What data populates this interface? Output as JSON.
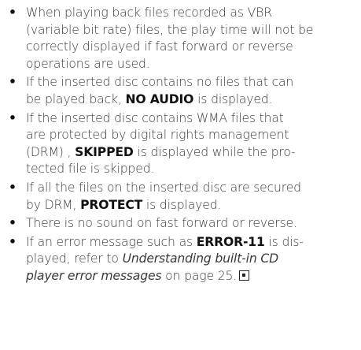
{
  "notes": [
    {
      "lines": [
        [
          {
            "t": "When playing back files recorded as VBR"
          }
        ],
        [
          {
            "t": "(variable bit rate) files, the play time will not be"
          }
        ],
        [
          {
            "t": "correctly displayed if fast forward or reverse"
          }
        ],
        [
          {
            "t": "operations are used."
          }
        ]
      ]
    },
    {
      "lines": [
        [
          {
            "t": "If the inserted disc contains no files that can"
          }
        ],
        [
          {
            "t": "be played back, "
          },
          {
            "t": "NO AUDIO",
            "s": "b"
          },
          {
            "t": " is displayed."
          }
        ]
      ]
    },
    {
      "lines": [
        [
          {
            "t": "If the inserted disc contains WMA files that"
          }
        ],
        [
          {
            "t": "are protected by digital rights management"
          }
        ],
        [
          {
            "t": "(DRM) , "
          },
          {
            "t": "SKIPPED",
            "s": "b"
          },
          {
            "t": " is displayed while the pro-"
          }
        ],
        [
          {
            "t": "tected file is skipped."
          }
        ]
      ]
    },
    {
      "lines": [
        [
          {
            "t": "If all the files on the inserted disc are secured"
          }
        ],
        [
          {
            "t": "by DRM, "
          },
          {
            "t": "PROTECT",
            "s": "b"
          },
          {
            "t": " is displayed."
          }
        ]
      ]
    },
    {
      "lines": [
        [
          {
            "t": "There is no sound on fast forward or reverse."
          }
        ]
      ]
    },
    {
      "lines": [
        [
          {
            "t": "If an error message such as "
          },
          {
            "t": "ERROR-11",
            "s": "b"
          },
          {
            "t": " is dis-"
          }
        ],
        [
          {
            "t": "played, refer to "
          },
          {
            "t": "Understanding built-in CD",
            "s": "i"
          }
        ],
        [
          {
            "t": "player error messages",
            "s": "i"
          },
          {
            "t": " on page 25."
          }
        ]
      ],
      "end_mark": "end-of-section-icon"
    }
  ]
}
